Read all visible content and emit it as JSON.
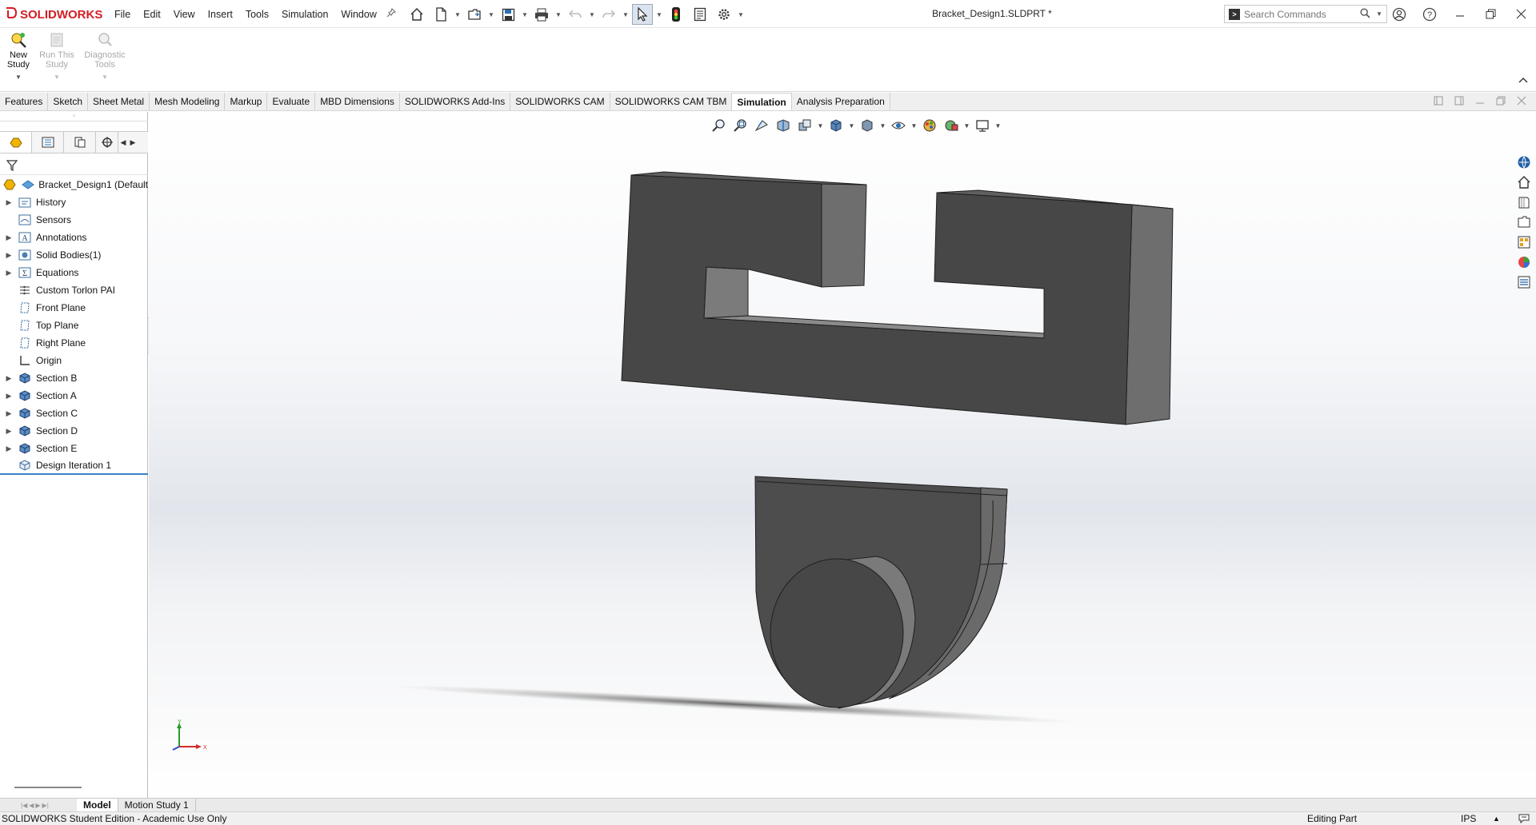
{
  "app": {
    "name": "SOLIDWORKS",
    "document_title": "Bracket_Design1.SLDPRT *"
  },
  "menu": [
    "File",
    "Edit",
    "View",
    "Insert",
    "Tools",
    "Simulation",
    "Window"
  ],
  "search": {
    "placeholder": "Search Commands"
  },
  "command_manager": {
    "new_study": "New Study",
    "run_study": "Run This Study",
    "diagnostic_tools": "Diagnostic Tools"
  },
  "tabs": [
    {
      "label": "Features",
      "active": false
    },
    {
      "label": "Sketch",
      "active": false
    },
    {
      "label": "Sheet Metal",
      "active": false
    },
    {
      "label": "Mesh Modeling",
      "active": false
    },
    {
      "label": "Markup",
      "active": false
    },
    {
      "label": "Evaluate",
      "active": false
    },
    {
      "label": "MBD Dimensions",
      "active": false
    },
    {
      "label": "SOLIDWORKS Add-Ins",
      "active": false
    },
    {
      "label": "SOLIDWORKS CAM",
      "active": false
    },
    {
      "label": "SOLIDWORKS CAM TBM",
      "active": false
    },
    {
      "label": "Simulation",
      "active": true
    },
    {
      "label": "Analysis Preparation",
      "active": false
    }
  ],
  "feature_tree": {
    "root": "Bracket_Design1 (Default",
    "items": [
      {
        "label": "History",
        "expandable": true,
        "icon": "folder-icon"
      },
      {
        "label": "Sensors",
        "expandable": false,
        "icon": "sensor-icon"
      },
      {
        "label": "Annotations",
        "expandable": true,
        "icon": "annotation-icon"
      },
      {
        "label": "Solid Bodies(1)",
        "expandable": true,
        "icon": "solid-bodies-icon"
      },
      {
        "label": "Equations",
        "expandable": true,
        "icon": "equations-icon"
      },
      {
        "label": "Custom Torlon PAI",
        "expandable": false,
        "icon": "material-icon"
      },
      {
        "label": "Front Plane",
        "expandable": false,
        "icon": "plane-icon"
      },
      {
        "label": "Top Plane",
        "expandable": false,
        "icon": "plane-icon"
      },
      {
        "label": "Right Plane",
        "expandable": false,
        "icon": "plane-icon"
      },
      {
        "label": "Origin",
        "expandable": false,
        "icon": "origin-icon"
      },
      {
        "label": "Section B",
        "expandable": true,
        "icon": "boss-extrude-icon"
      },
      {
        "label": "Section A",
        "expandable": true,
        "icon": "boss-extrude-icon"
      },
      {
        "label": "Section C",
        "expandable": true,
        "icon": "boss-extrude-icon"
      },
      {
        "label": "Section D",
        "expandable": true,
        "icon": "boss-extrude-icon"
      },
      {
        "label": "Section E",
        "expandable": true,
        "icon": "boss-extrude-icon"
      },
      {
        "label": "Design Iteration 1",
        "expandable": false,
        "icon": "design-study-icon"
      }
    ]
  },
  "triad": {
    "y": "Y",
    "x": "X"
  },
  "bottom_tabs": [
    {
      "label": "Model",
      "active": true
    },
    {
      "label": "Motion Study 1",
      "active": false
    }
  ],
  "status": {
    "left": "SOLIDWORKS Student Edition - Academic Use Only",
    "editing": "Editing Part",
    "units": "IPS"
  },
  "colors": {
    "brand": "#d41d24",
    "part_dark": "#4a4a4a",
    "part_mid": "#6c6c6c",
    "selection_blue": "#3c82c7"
  }
}
